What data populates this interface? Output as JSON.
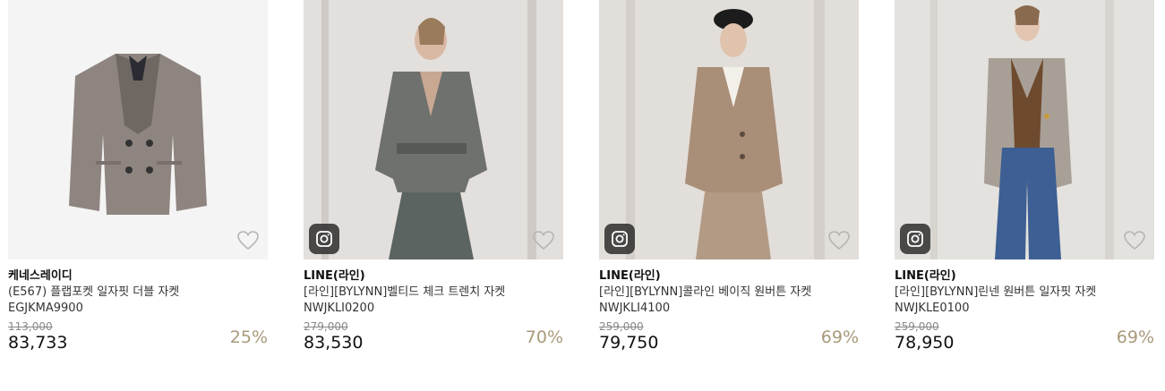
{
  "products": [
    {
      "brand": "케네스레이디",
      "name": "(E567) 플랩포켓 일자핏 더블 자켓",
      "code": "EGJKMA9900",
      "original_price": "113,000",
      "price": "83,733",
      "discount": "25%",
      "has_instagram_badge": false
    },
    {
      "brand": "LINE(라인)",
      "name": "[라인][BYLYNN]벨티드 체크 트렌치 자켓",
      "code": "NWJKLI0200",
      "original_price": "279,000",
      "price": "83,530",
      "discount": "70%",
      "has_instagram_badge": true
    },
    {
      "brand": "LINE(라인)",
      "name": "[라인][BYLYNN]콜라인 베이직 원버튼 자켓",
      "code": "NWJKLI4100",
      "original_price": "259,000",
      "price": "79,750",
      "discount": "69%",
      "has_instagram_badge": true
    },
    {
      "brand": "LINE(라인)",
      "name": "[라인][BYLYNN]린넨 원버튼 일자핏 자켓",
      "code": "NWJKLE0100",
      "original_price": "259,000",
      "price": "78,950",
      "discount": "69%",
      "has_instagram_badge": true
    }
  ],
  "colors": {
    "discount": "#a89a7a",
    "strike_price": "#888888",
    "badge_bg": "#1e1e1e"
  },
  "icons": {
    "wishlist": "heart-outline-icon",
    "instagram": "instagram-icon"
  }
}
